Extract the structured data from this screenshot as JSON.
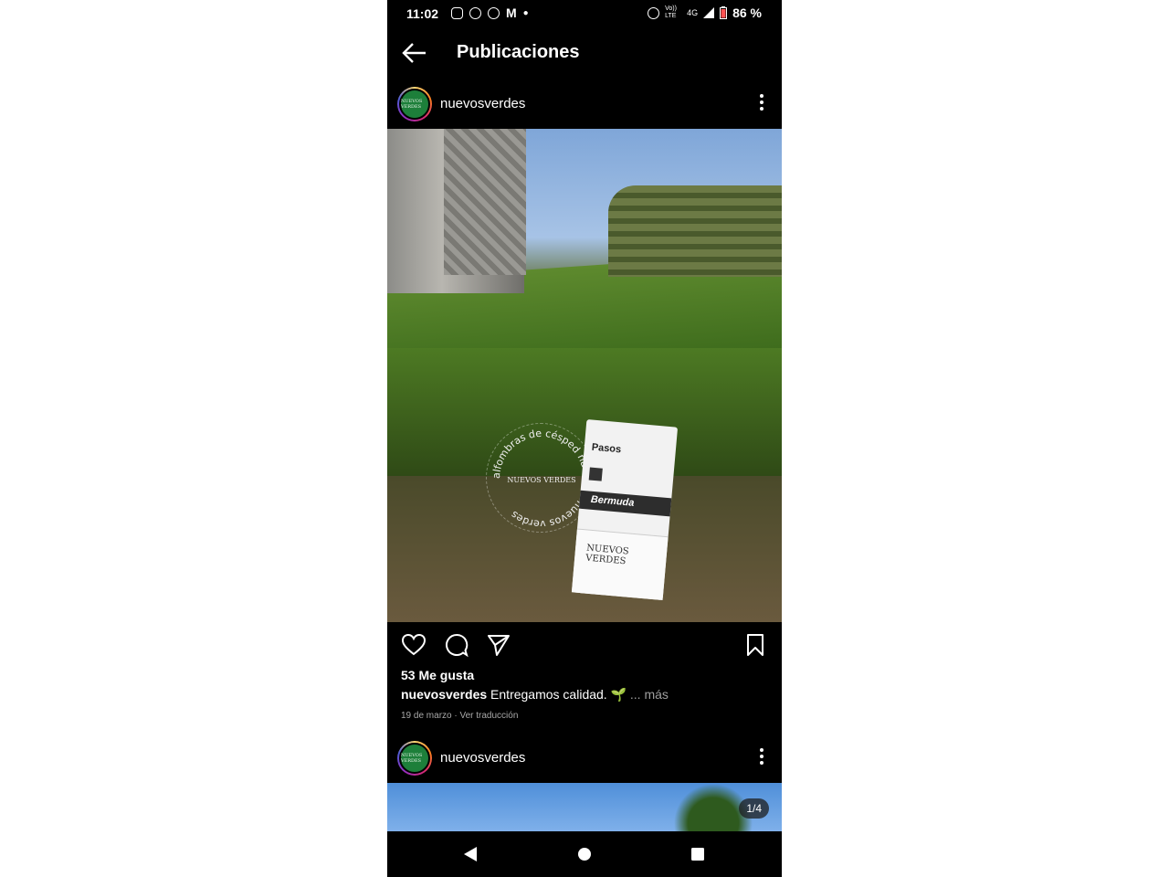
{
  "status_bar": {
    "time": "11:02",
    "network_label": "4G",
    "volte_label": "Vo)) LTE",
    "battery": "86 %"
  },
  "app_bar": {
    "title": "Publicaciones"
  },
  "post1": {
    "username": "nuevosverdes",
    "avatar_text": "NUEVOS VERDES",
    "image_stamp_text": "alfombras de césped natural · nuevos verdes",
    "image_stamp_center": "NUEVOS VERDES",
    "card_title": "Pasos",
    "card_band": "Bermuda",
    "card_logo": "NUEVOS VERDES",
    "likes": "53 Me gusta",
    "caption_user": "nuevosverdes",
    "caption_text": " Entregamos calidad. 🌱",
    "caption_more": "... más",
    "date_and_translate": "19 de marzo · Ver traducción"
  },
  "post2": {
    "username": "nuevosverdes",
    "avatar_text": "NUEVOS VERDES",
    "image_counter": "1/4"
  },
  "icons": {
    "back": "arrow-left-icon",
    "like": "heart-icon",
    "comment": "comment-icon",
    "share": "send-icon",
    "save": "bookmark-icon",
    "more": "more-vertical-icon",
    "nav_back": "triangle-back-icon",
    "nav_home": "circle-home-icon",
    "nav_recents": "square-recents-icon"
  }
}
